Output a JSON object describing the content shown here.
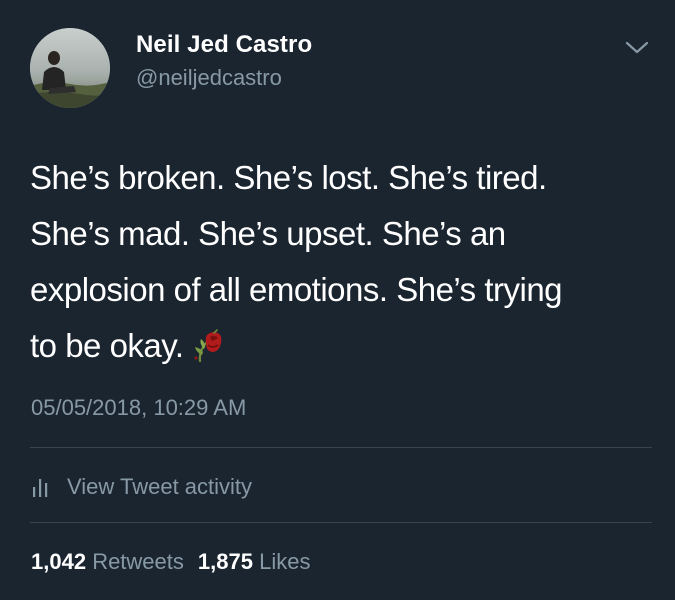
{
  "tweet": {
    "author": {
      "display_name": "Neil Jed Castro",
      "username": "@neiljedcastro"
    },
    "text": "She’s broken. She’s lost. She’s tired.\nShe’s mad. She’s upset. She’s an\nexplosion of all emotions. She’s trying\nto be okay.",
    "emoji": "wilted-flower-icon",
    "timestamp": "05/05/2018, 10:29 AM",
    "activity_label": "View Tweet activity",
    "stats": {
      "retweets_count": "1,042",
      "retweets_label": "Retweets",
      "likes_count": "1,875",
      "likes_label": "Likes"
    }
  },
  "colors": {
    "background": "#1b2530",
    "secondary_text": "#8899a6",
    "divider": "#38444d"
  }
}
